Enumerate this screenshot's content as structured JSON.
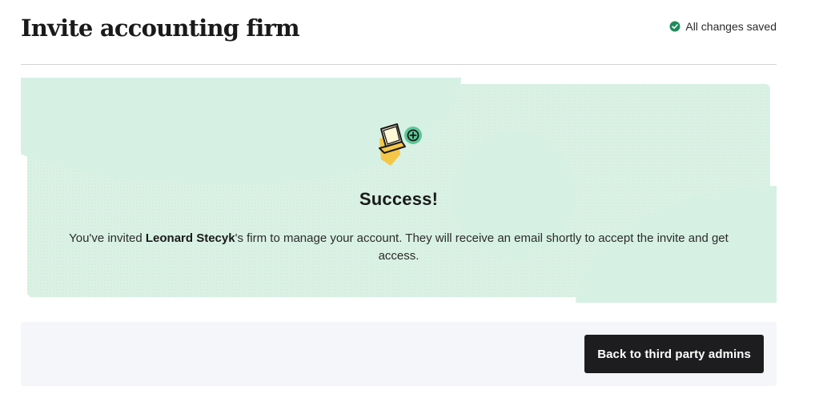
{
  "header": {
    "title": "Invite accounting firm",
    "save_status": "All changes saved",
    "save_status_icon": "check-circle-icon",
    "status_color": "#1f8a5b"
  },
  "hero": {
    "illustration": "laptop-add-icon",
    "title": "Success!",
    "message_prefix": "You've invited ",
    "invitee_name": "Leonard Stecyk",
    "message_suffix": "'s firm to manage your account. They will receive an email shortly to accept the invite and get access.",
    "accent_color": "#d6f0e4"
  },
  "footer": {
    "back_button_label": "Back to third party admins"
  }
}
